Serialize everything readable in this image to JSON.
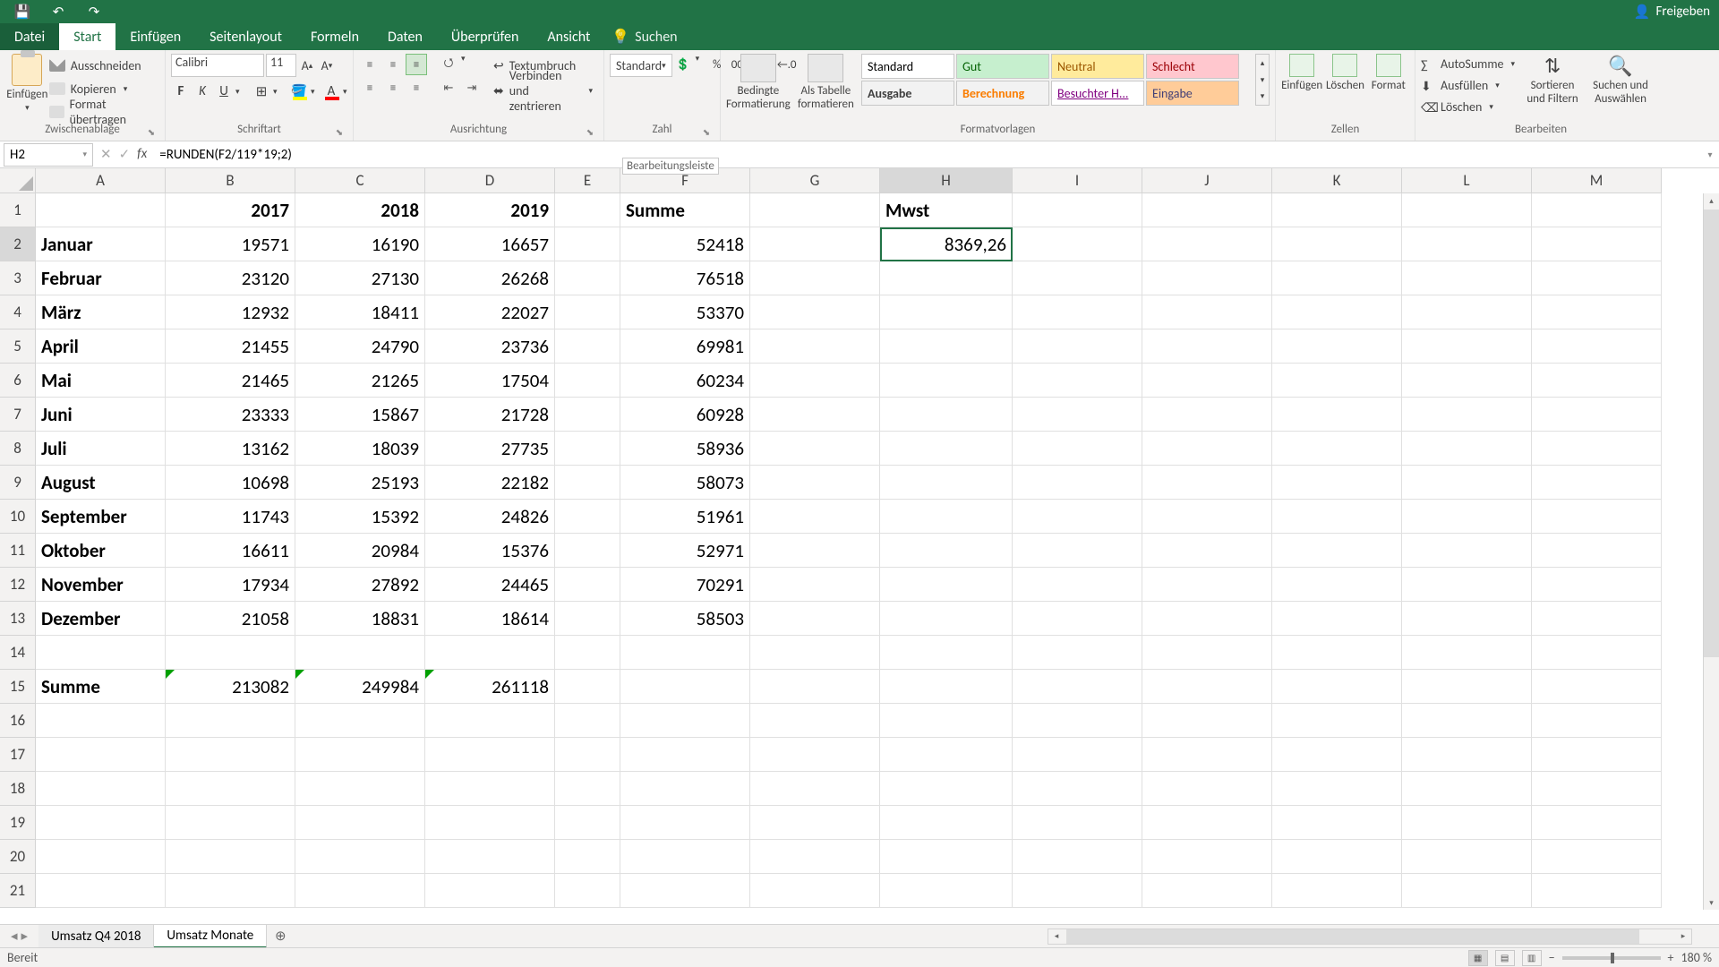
{
  "titlebar": {
    "share": "Freigeben"
  },
  "menu": {
    "file": "Datei",
    "tabs": [
      "Start",
      "Einfügen",
      "Seitenlayout",
      "Formeln",
      "Daten",
      "Überprüfen",
      "Ansicht"
    ],
    "active": "Start",
    "search": "Suchen"
  },
  "ribbon": {
    "clipboard": {
      "paste": "Einfügen",
      "cut": "Ausschneiden",
      "copy": "Kopieren",
      "format": "Format übertragen",
      "label": "Zwischenablage"
    },
    "font": {
      "name": "Calibri",
      "size": "11",
      "label": "Schriftart"
    },
    "align": {
      "wrap": "Textumbruch",
      "merge": "Verbinden und zentrieren",
      "label": "Ausrichtung"
    },
    "number": {
      "format": "Standard",
      "label": "Zahl"
    },
    "styles": {
      "cond": "Bedingte Formatierung",
      "table": "Als Tabelle formatieren",
      "items": [
        "Standard",
        "Gut",
        "Neutral",
        "Schlecht",
        "Ausgabe",
        "Berechnung",
        "Besuchter H...",
        "Eingabe"
      ],
      "label": "Formatvorlagen"
    },
    "cells": {
      "insert": "Einfügen",
      "delete": "Löschen",
      "format": "Format",
      "label": "Zellen"
    },
    "edit": {
      "sum": "AutoSumme",
      "fill": "Ausfüllen",
      "clear": "Löschen",
      "sort": "Sortieren und Filtern",
      "find": "Suchen und Auswählen",
      "label": "Bearbeiten"
    }
  },
  "formulabar": {
    "cellref": "H2",
    "formula": "=RUNDEN(F2/119*19;2)",
    "tooltip": "Bearbeitungsleiste"
  },
  "columns": [
    "A",
    "B",
    "C",
    "D",
    "E",
    "F",
    "G",
    "H",
    "I",
    "J",
    "K",
    "L",
    "M"
  ],
  "rows_count": 21,
  "selected": {
    "row": 2,
    "col": "H"
  },
  "data": {
    "headers": {
      "B1": "2017",
      "C1": "2018",
      "D1": "2019",
      "F1": "Summe",
      "H1": "Mwst"
    },
    "rowlabels": [
      "Januar",
      "Februar",
      "März",
      "April",
      "Mai",
      "Juni",
      "Juli",
      "August",
      "September",
      "Oktober",
      "November",
      "Dezember"
    ],
    "values": {
      "B": [
        19571,
        23120,
        12932,
        21455,
        21465,
        23333,
        13162,
        10698,
        11743,
        16611,
        17934,
        21058
      ],
      "C": [
        16190,
        27130,
        18411,
        24790,
        21265,
        15867,
        18039,
        25193,
        15392,
        20984,
        27892,
        18831
      ],
      "D": [
        16657,
        26268,
        22027,
        23736,
        17504,
        21728,
        27735,
        22182,
        24826,
        15376,
        24465,
        18614
      ],
      "F": [
        52418,
        76518,
        53370,
        69981,
        60234,
        60928,
        58936,
        58073,
        51961,
        52971,
        70291,
        58503
      ]
    },
    "summe_label": "Summe",
    "summe": {
      "B": 213082,
      "C": 249984,
      "D": 261118
    },
    "mwst": "8369,26"
  },
  "sheets": {
    "tabs": [
      "Umsatz Q4 2018",
      "Umsatz Monate"
    ],
    "active": "Umsatz Monate"
  },
  "status": {
    "ready": "Bereit",
    "zoom": "180 %"
  }
}
